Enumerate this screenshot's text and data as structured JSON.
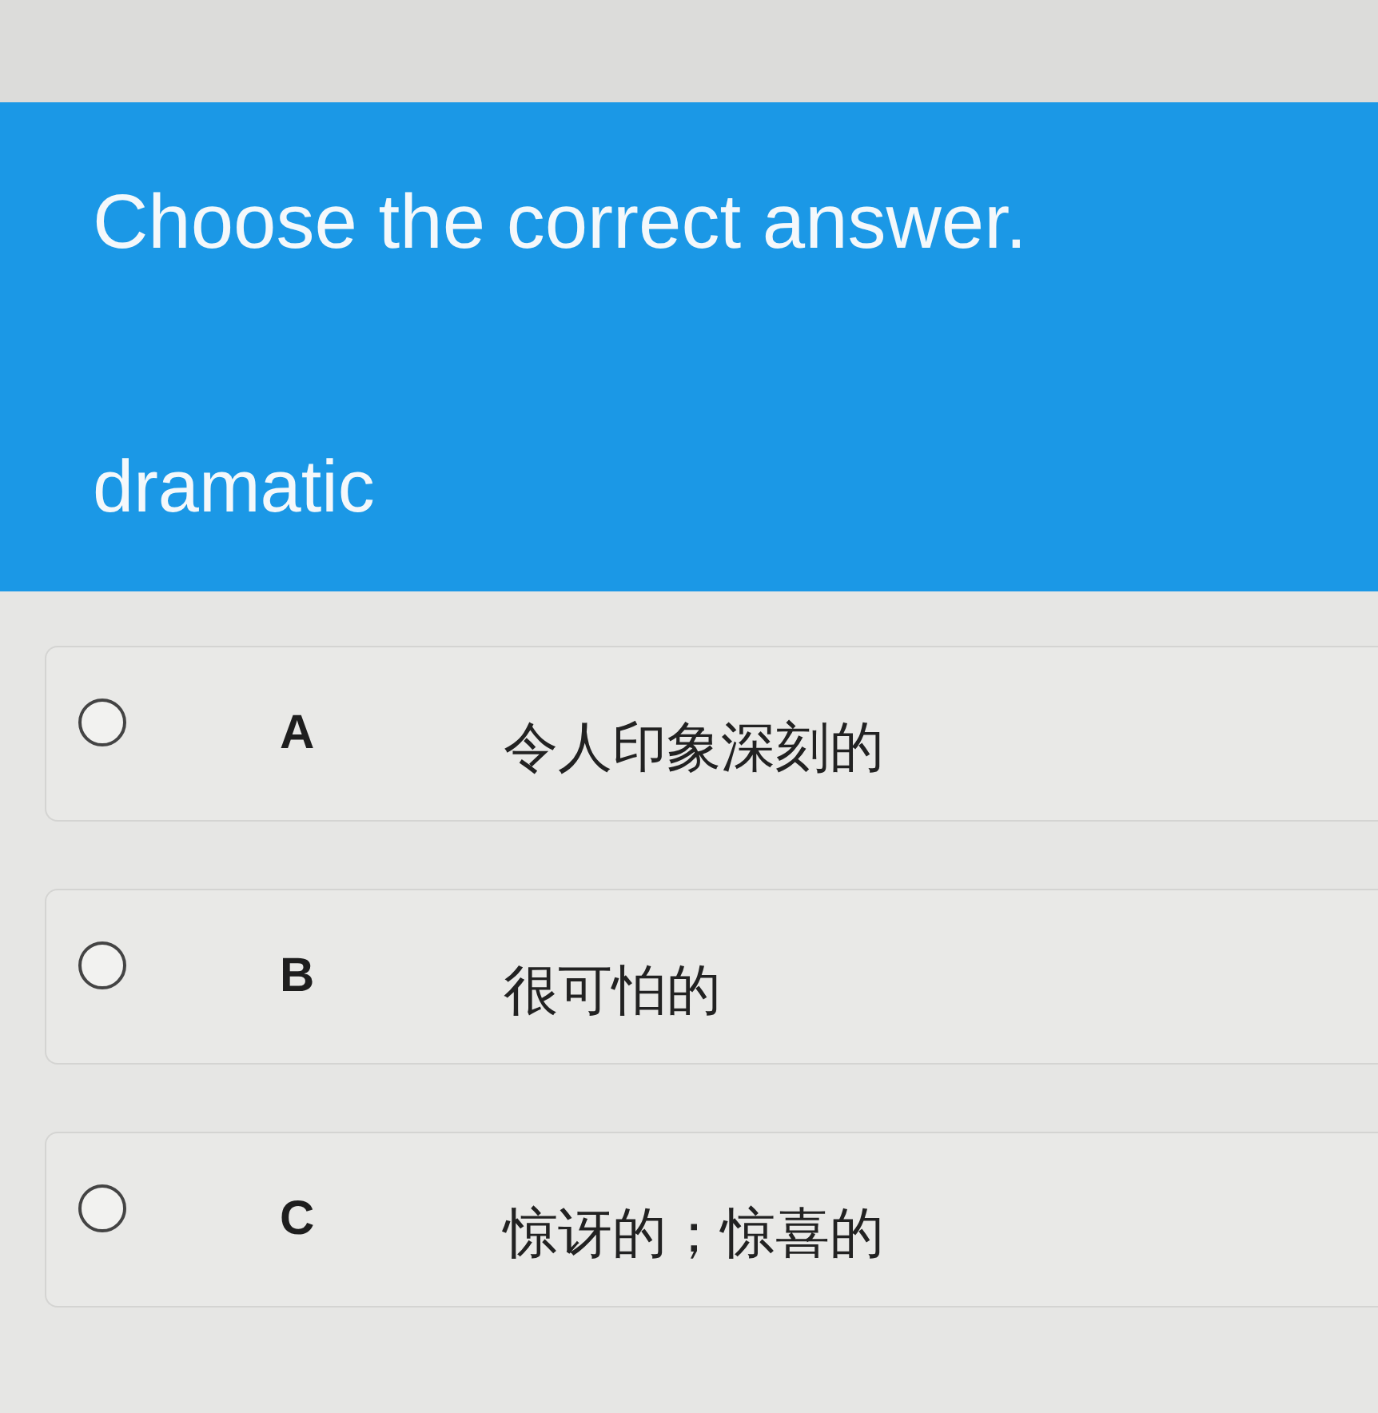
{
  "header": {
    "instruction": "Choose the correct answer.",
    "word": "dramatic"
  },
  "options": [
    {
      "letter": "A",
      "text": "令人印象深刻的",
      "selected": false
    },
    {
      "letter": "B",
      "text": "很可怕的",
      "selected": false
    },
    {
      "letter": "C",
      "text": "惊讶的；惊喜的",
      "selected": false
    }
  ]
}
